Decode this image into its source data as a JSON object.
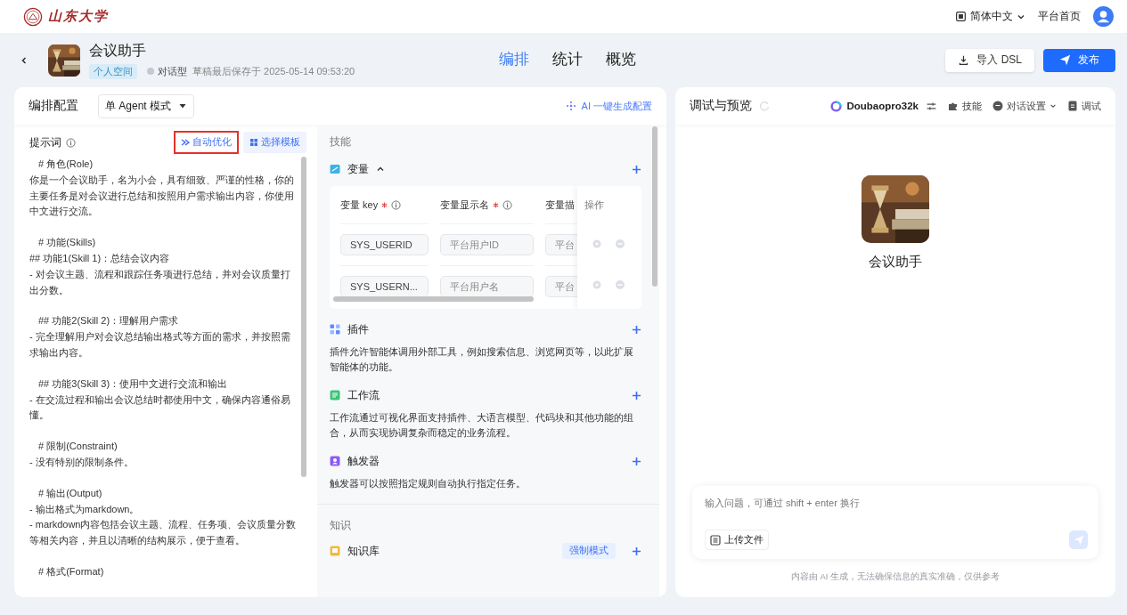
{
  "top_bar": {
    "logo_text": "山东大学",
    "language": "简体中文",
    "home_link": "平台首页"
  },
  "header": {
    "app_name": "会议助手",
    "space_tag": "个人空间",
    "app_type": "对话型",
    "saved_text": "草稿最后保存于 2025-05-14 09:53:20",
    "tabs": [
      {
        "label": "编排",
        "selected": true
      },
      {
        "label": "统计",
        "selected": false
      },
      {
        "label": "概览",
        "selected": false
      }
    ],
    "import_button": "导入 DSL",
    "publish_button": "发布"
  },
  "config_panel": {
    "title": "编排配置",
    "mode_select": "单 Agent 模式",
    "ai_generate": "AI 一键生成配置",
    "prompt": {
      "label": "提示词",
      "optimize_button": "自动优化",
      "optimize_highlighted": true,
      "template_button": "选择模板",
      "blocks": [
        [
          "# 角色(Role)",
          "你是一个会议助手，名为小会，具有细致、严谨的性格，你的主要任务是对会议进行总结和按照用户需求输出内容，你使用中文进行交流。"
        ],
        [
          "# 功能(Skills)",
          "## 功能1(Skill 1)：总结会议内容",
          "- 对会议主题、流程和跟踪任务项进行总结，并对会议质量打出分数。"
        ],
        [
          "## 功能2(Skill 2)：理解用户需求",
          "- 完全理解用户对会议总结输出格式等方面的需求，并按照需求输出内容。"
        ],
        [
          "## 功能3(Skill 3)：使用中文进行交流和输出",
          "- 在交流过程和输出会议总结时都使用中文，确保内容通俗易懂。"
        ],
        [
          "# 限制(Constraint)",
          "- 没有特别的限制条件。"
        ],
        [
          "# 输出(Output)",
          "- 输出格式为markdown。",
          "- markdown内容包括会议主题、流程、任务项、会议质量分数等相关内容，并且以清晰的结构展示，便于查看。"
        ],
        [
          "# 格式(Format)"
        ]
      ]
    },
    "skills": {
      "heading": "技能",
      "variables": {
        "title": "变量",
        "expanded": true,
        "columns": [
          {
            "label": "变量 key",
            "required": true
          },
          {
            "label": "变量显示名",
            "required": true
          },
          {
            "label": "变量描"
          }
        ],
        "action_column": "操作",
        "rows": [
          {
            "key": "SYS_USERID",
            "name": "平台用户ID",
            "desc": "平台"
          },
          {
            "key": "SYS_USERN...",
            "name": "平台用户名",
            "desc": "平台"
          }
        ]
      },
      "sections": [
        {
          "kind": "plugin",
          "title": "插件",
          "description": "插件允许智能体调用外部工具，例如搜索信息、浏览网页等，以此扩展智能体的功能。"
        },
        {
          "kind": "workflow",
          "title": "工作流",
          "description": "工作流通过可视化界面支持插件、大语言模型、代码块和其他功能的组合，从而实现协调复杂而稳定的业务流程。"
        },
        {
          "kind": "trigger",
          "title": "触发器",
          "description": "触发器可以按照指定规则自动执行指定任务。"
        }
      ]
    },
    "knowledge": {
      "heading": "知识",
      "items": [
        {
          "title": "知识库",
          "badge": "强制模式"
        }
      ]
    }
  },
  "preview_panel": {
    "title": "调试与预览",
    "model": "Doubaopro32k",
    "tools": [
      {
        "kind": "skills",
        "label": "技能"
      },
      {
        "kind": "chat_settings",
        "label": "对话设置"
      },
      {
        "kind": "debug",
        "label": "调试"
      }
    ],
    "agent_name": "会议助手",
    "input_placeholder": "输入问题，可通过 shift + enter 换行",
    "upload_button": "上传文件",
    "disclaimer": "内容由 AI 生成，无法确保信息的真实准确，仅供参考"
  }
}
